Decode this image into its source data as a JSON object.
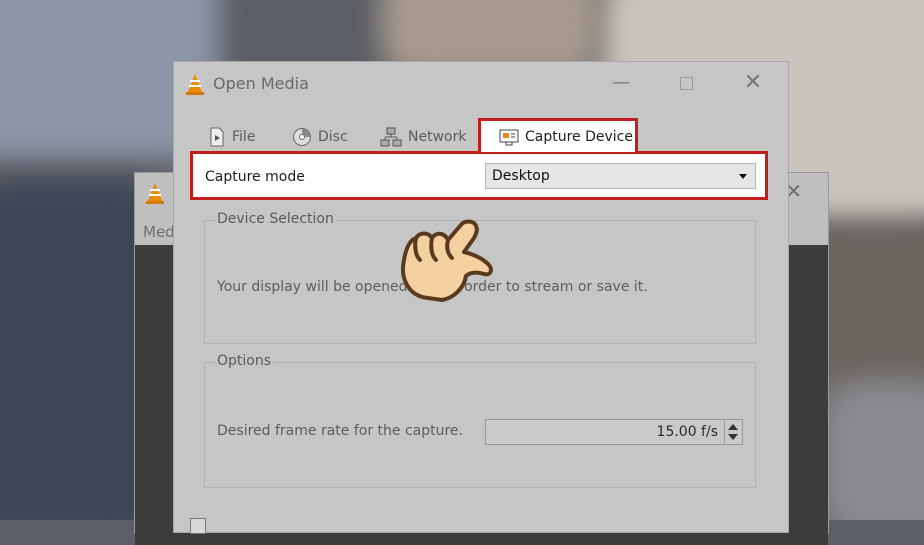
{
  "back_window": {
    "menu_label": "Med"
  },
  "dialog": {
    "title": "Open Media",
    "close_glyph": "✕",
    "minimize_glyph": "—"
  },
  "tabs": [
    {
      "label": "File",
      "icon": "file-icon"
    },
    {
      "label": "Disc",
      "icon": "disc-icon"
    },
    {
      "label": "Network",
      "icon": "network-icon"
    },
    {
      "label": "Capture Device",
      "icon": "capture-device-icon",
      "active": true
    }
  ],
  "capture": {
    "mode_label": "Capture mode",
    "mode_value": "Desktop"
  },
  "device_selection": {
    "heading": "Device Selection",
    "text": "Your display will be opened a      ed in order to stream or save it."
  },
  "options": {
    "heading": "Options",
    "frame_rate_label": "Desired frame rate for the capture.",
    "frame_rate_value": "15.00 f/s"
  },
  "colors": {
    "highlight": "#c21c1c",
    "vlc_orange": "#f08a00"
  }
}
